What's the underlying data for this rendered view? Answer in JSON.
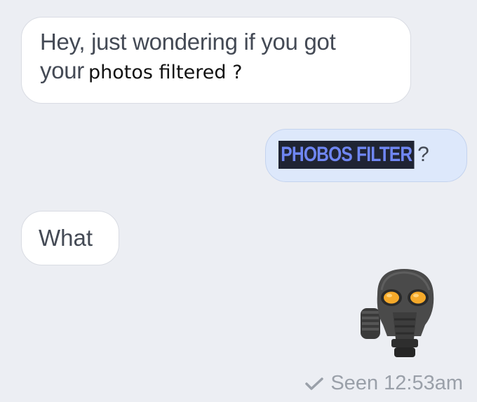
{
  "conversation": {
    "messages": [
      {
        "sender": "other",
        "line1": "Hey, just wondering if you got",
        "line2_prefix": "your",
        "line2_overlay": "photos filtered ?"
      },
      {
        "sender": "self",
        "highlighted_text": "PHOBOS FILTER",
        "suffix": "?"
      },
      {
        "sender": "other",
        "text": "What"
      },
      {
        "sender": "self",
        "sticker": "gas-mask-icon"
      }
    ],
    "read_receipt": {
      "icon": "checkmark-icon",
      "text": "Seen 12:53am"
    }
  },
  "colors": {
    "background": "#eceef3",
    "incoming_bubble": "#ffffff",
    "outgoing_bubble": "#dde8fb",
    "highlight_bg": "#1f2433",
    "highlight_text": "#6f86f2",
    "mask_eyes": "#f5a92a"
  }
}
